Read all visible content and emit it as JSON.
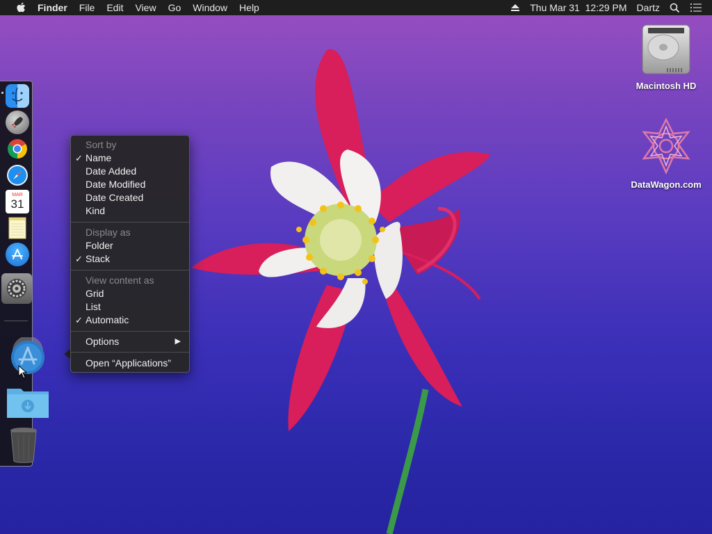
{
  "menubar": {
    "app_name": "Finder",
    "menus": [
      "File",
      "Edit",
      "View",
      "Go",
      "Window",
      "Help"
    ],
    "clock": "Thu Mar 31  12:29 PM",
    "user": "Dartz"
  },
  "desktop": {
    "icons": [
      {
        "label": "Macintosh HD",
        "icon": "hard-drive-icon"
      },
      {
        "label": "DataWagon.com",
        "icon": "datawagon-icon"
      }
    ]
  },
  "dock": {
    "items": [
      {
        "icon": "finder-icon",
        "running": true
      },
      {
        "icon": "launchpad-icon",
        "running": false
      },
      {
        "icon": "chrome-icon",
        "running": false
      },
      {
        "icon": "safari-icon",
        "running": false
      },
      {
        "icon": "calendar-icon",
        "running": false,
        "month": "MAR",
        "day": "31"
      },
      {
        "icon": "notes-icon",
        "running": false
      },
      {
        "icon": "app-store-icon",
        "running": false
      },
      {
        "icon": "system-preferences-icon",
        "running": false
      },
      {
        "icon": "applications-stack-icon",
        "running": false
      },
      {
        "icon": "downloads-folder-icon",
        "running": false
      },
      {
        "icon": "trash-icon",
        "running": false
      }
    ]
  },
  "context_menu": {
    "sort_by": {
      "header": "Sort by",
      "options": [
        {
          "label": "Name",
          "checked": true
        },
        {
          "label": "Date Added",
          "checked": false
        },
        {
          "label": "Date Modified",
          "checked": false
        },
        {
          "label": "Date Created",
          "checked": false
        },
        {
          "label": "Kind",
          "checked": false
        }
      ]
    },
    "display_as": {
      "header": "Display as",
      "options": [
        {
          "label": "Folder",
          "checked": false
        },
        {
          "label": "Stack",
          "checked": true
        }
      ]
    },
    "view_content_as": {
      "header": "View content as",
      "options": [
        {
          "label": "Grid",
          "checked": false
        },
        {
          "label": "List",
          "checked": false
        },
        {
          "label": "Automatic",
          "checked": true
        }
      ]
    },
    "options_label": "Options",
    "open_label": "Open “Applications”",
    "check_glyph": "✓"
  },
  "colors": {
    "menubar_bg": "#1e1e1e",
    "menu_bg": "#262626",
    "petal": "#d81e5b",
    "wallpaper_top": "#9a4fc0",
    "wallpaper_bottom": "#2622a0"
  }
}
